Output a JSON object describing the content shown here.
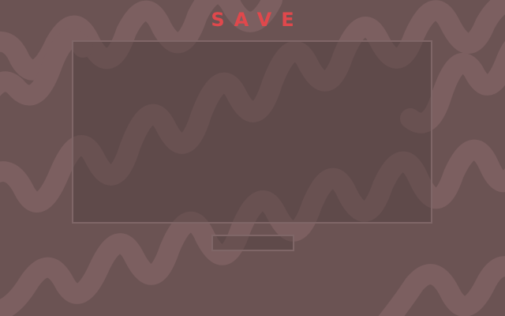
{
  "screen": {
    "title": "SAVE",
    "save_name": ""
  },
  "colors": {
    "background": "#6b5353",
    "wave": "#7c5f60",
    "title": "#e0484c",
    "panel_border": "#7f6667"
  }
}
